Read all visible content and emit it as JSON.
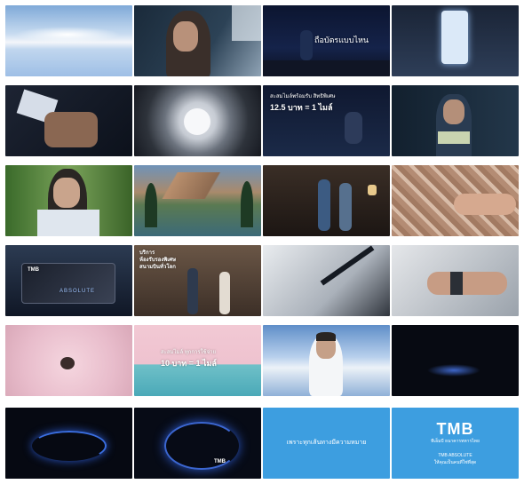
{
  "frames": [
    {
      "id": "f1",
      "caption": ""
    },
    {
      "id": "f2",
      "caption": ""
    },
    {
      "id": "f3",
      "caption": "ถือบัตรแบบไหน"
    },
    {
      "id": "f4",
      "caption": ""
    },
    {
      "id": "f5",
      "caption": ""
    },
    {
      "id": "f6",
      "caption": ""
    },
    {
      "id": "f7",
      "caption_line1": "สะสมไมล์พร้อมรับ สิทธิพิเศษ",
      "caption_line2": "12.5 บาท = 1 ไมล์"
    },
    {
      "id": "f8",
      "caption": ""
    },
    {
      "id": "f9",
      "caption": ""
    },
    {
      "id": "f10",
      "caption": ""
    },
    {
      "id": "f11",
      "caption": ""
    },
    {
      "id": "f12",
      "caption": ""
    },
    {
      "id": "f13",
      "card_brand": "TMB",
      "card_name": "ABSOLUTE"
    },
    {
      "id": "f14",
      "caption_line1": "บริการ",
      "caption_line2": "ห้องรับรองพิเศษ",
      "caption_line3": "สนามบินทั่วโลก"
    },
    {
      "id": "f15",
      "caption": ""
    },
    {
      "id": "f16",
      "caption": ""
    },
    {
      "id": "f17",
      "caption": ""
    },
    {
      "id": "f18",
      "caption_line1": "สะสมไมล์ ทุกการใช้จ่าย",
      "caption_line2": "10 บาท = 1 ไมล์"
    },
    {
      "id": "f19",
      "caption": ""
    },
    {
      "id": "f20",
      "caption": ""
    },
    {
      "id": "f21",
      "caption": ""
    },
    {
      "id": "f22",
      "caption": "TMB"
    },
    {
      "id": "f23",
      "caption": "เพราะทุกเส้นทางมีความหมาย"
    },
    {
      "id": "f24",
      "logo": "TMB",
      "sub1": "ทีเอ็มบี ธนาคารทหารไทย",
      "sub2": "TMB ABSOLUTE",
      "sub3": "ให้คุณเป็นคนที่ใช่ที่สุด"
    }
  ]
}
